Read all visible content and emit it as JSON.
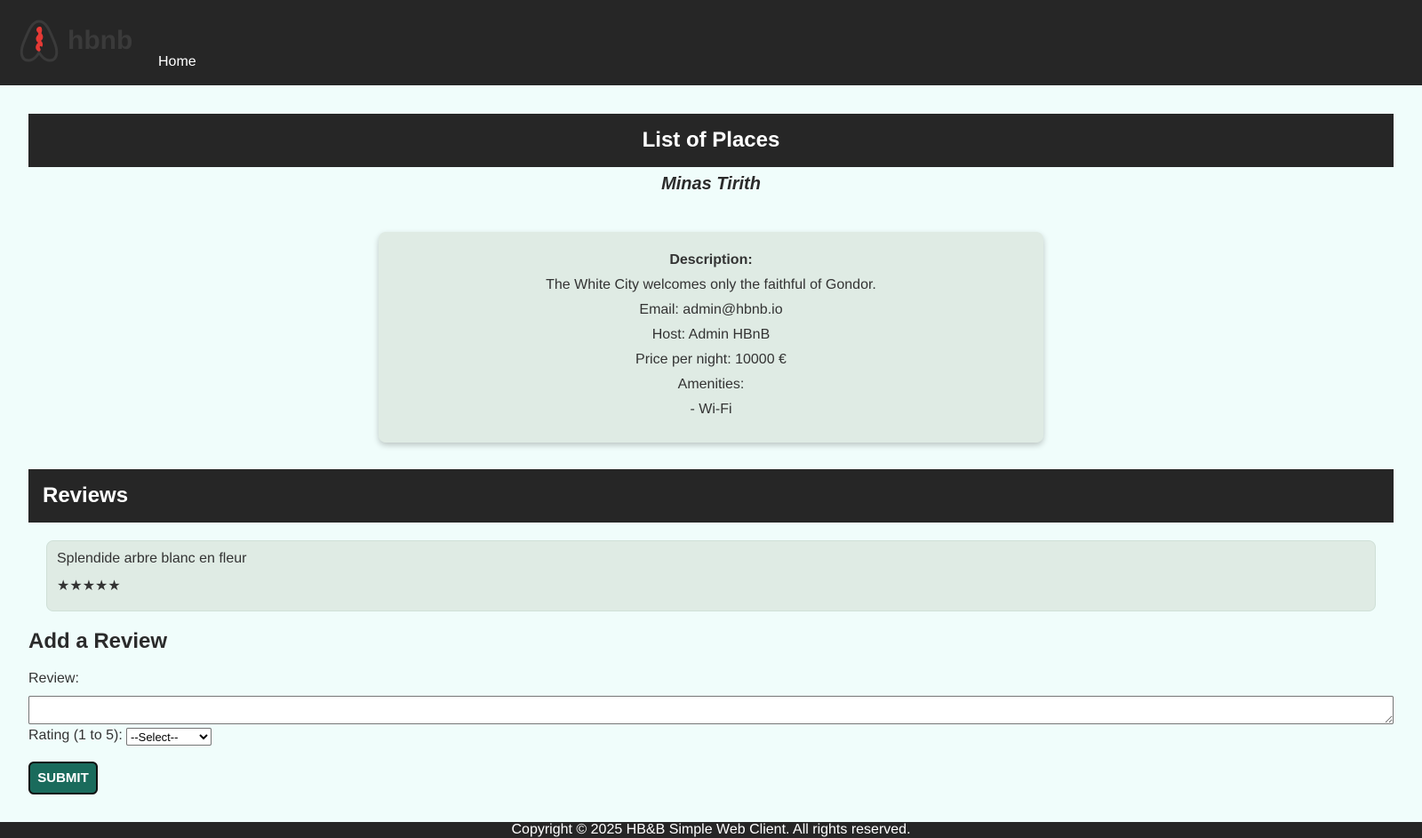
{
  "header": {
    "logo_text": "hbnb",
    "nav": {
      "home_label": "Home"
    }
  },
  "main": {
    "title": "List of Places",
    "place_name": "Minas Tirith",
    "details": {
      "description_label": "Description:",
      "description": "The White City welcomes only the faithful of Gondor.",
      "email": "Email: admin@hbnb.io",
      "host": "Host: Admin HBnB",
      "price": "Price per night: 10000 €",
      "amenities_label": "Amenities:",
      "amenities": [
        "- Wi-Fi"
      ]
    },
    "reviews_title": "Reviews",
    "reviews": [
      {
        "text": "Splendide arbre blanc en fleur",
        "stars": "★★★★★",
        "rating": 5
      }
    ]
  },
  "add_review": {
    "title": "Add a Review",
    "review_label": "Review:",
    "review_value": "",
    "rating_label": "Rating (1 to 5):",
    "rating_selected": "--Select--",
    "submit_label": "SUBMIT"
  },
  "footer": {
    "text": "Copyright © 2025 HB&B Simple Web Client. All rights reserved."
  },
  "colors": {
    "header_bg": "#262626",
    "page_bg": "#f0fdfb",
    "card_bg": "#dfebe4",
    "submit_bg": "#1a6b5c",
    "logo_accent": "#e53935"
  }
}
